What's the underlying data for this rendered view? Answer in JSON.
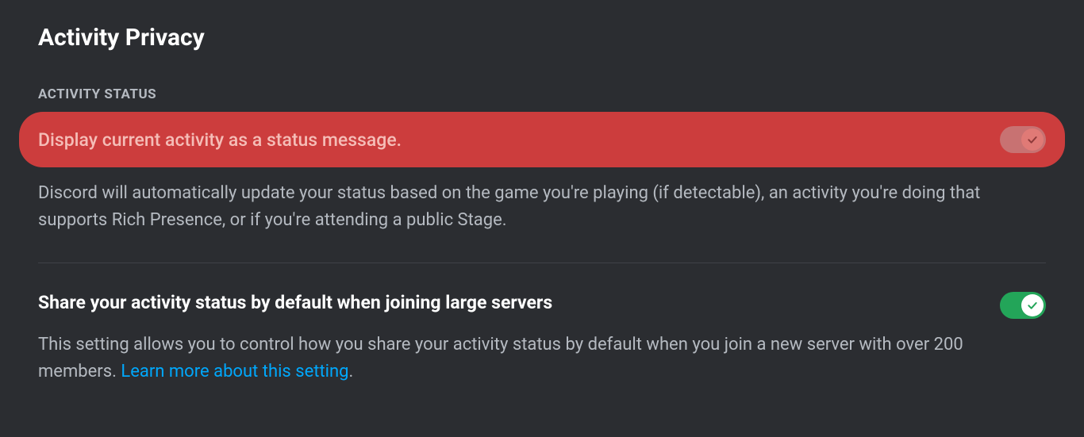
{
  "page": {
    "title": "Activity Privacy"
  },
  "section": {
    "header": "ACTIVITY STATUS"
  },
  "settings": {
    "display_activity": {
      "title": "Display current activity as a status message.",
      "description": "Discord will automatically update your status based on the game you're playing (if detectable), an activity you're doing that supports Rich Presence, or if you're attending a public Stage."
    },
    "share_large_servers": {
      "title": "Share your activity status by default when joining large servers",
      "description_pre": "This setting allows you to control how you share your activity status by default when you join a new server with over 200 members. ",
      "link": "Learn more about this setting",
      "description_post": "."
    }
  }
}
